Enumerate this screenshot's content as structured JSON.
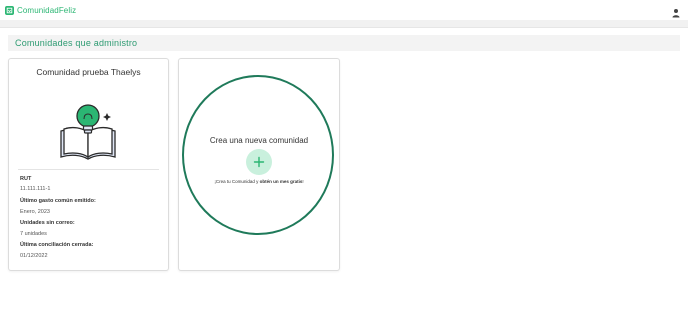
{
  "app": {
    "name": "ComunidadFeliz",
    "brand_color": "#2bb673"
  },
  "header": {
    "user_icon": "user-icon"
  },
  "section": {
    "title": "Comunidades que administro"
  },
  "community_card": {
    "title": "Comunidad prueba Thaelys",
    "illustration_icon": "book-lightbulb-icon",
    "fields": [
      {
        "label": "RUT",
        "value": "11.111.111-1"
      },
      {
        "label": "Último gasto común emitido:",
        "value": "Enero, 2023"
      },
      {
        "label": "Unidades sin correo:",
        "value": "7 unidades"
      },
      {
        "label": "Última conciliación cerrada:",
        "value": "01/12/2022"
      }
    ]
  },
  "create_card": {
    "title": "Crea una nueva comunidad",
    "plus_icon": "plus-icon",
    "subtitle_prefix": "¡Crea tu Comunidad y ",
    "subtitle_bold": "obtén un mes gratis",
    "subtitle_suffix": "!"
  }
}
